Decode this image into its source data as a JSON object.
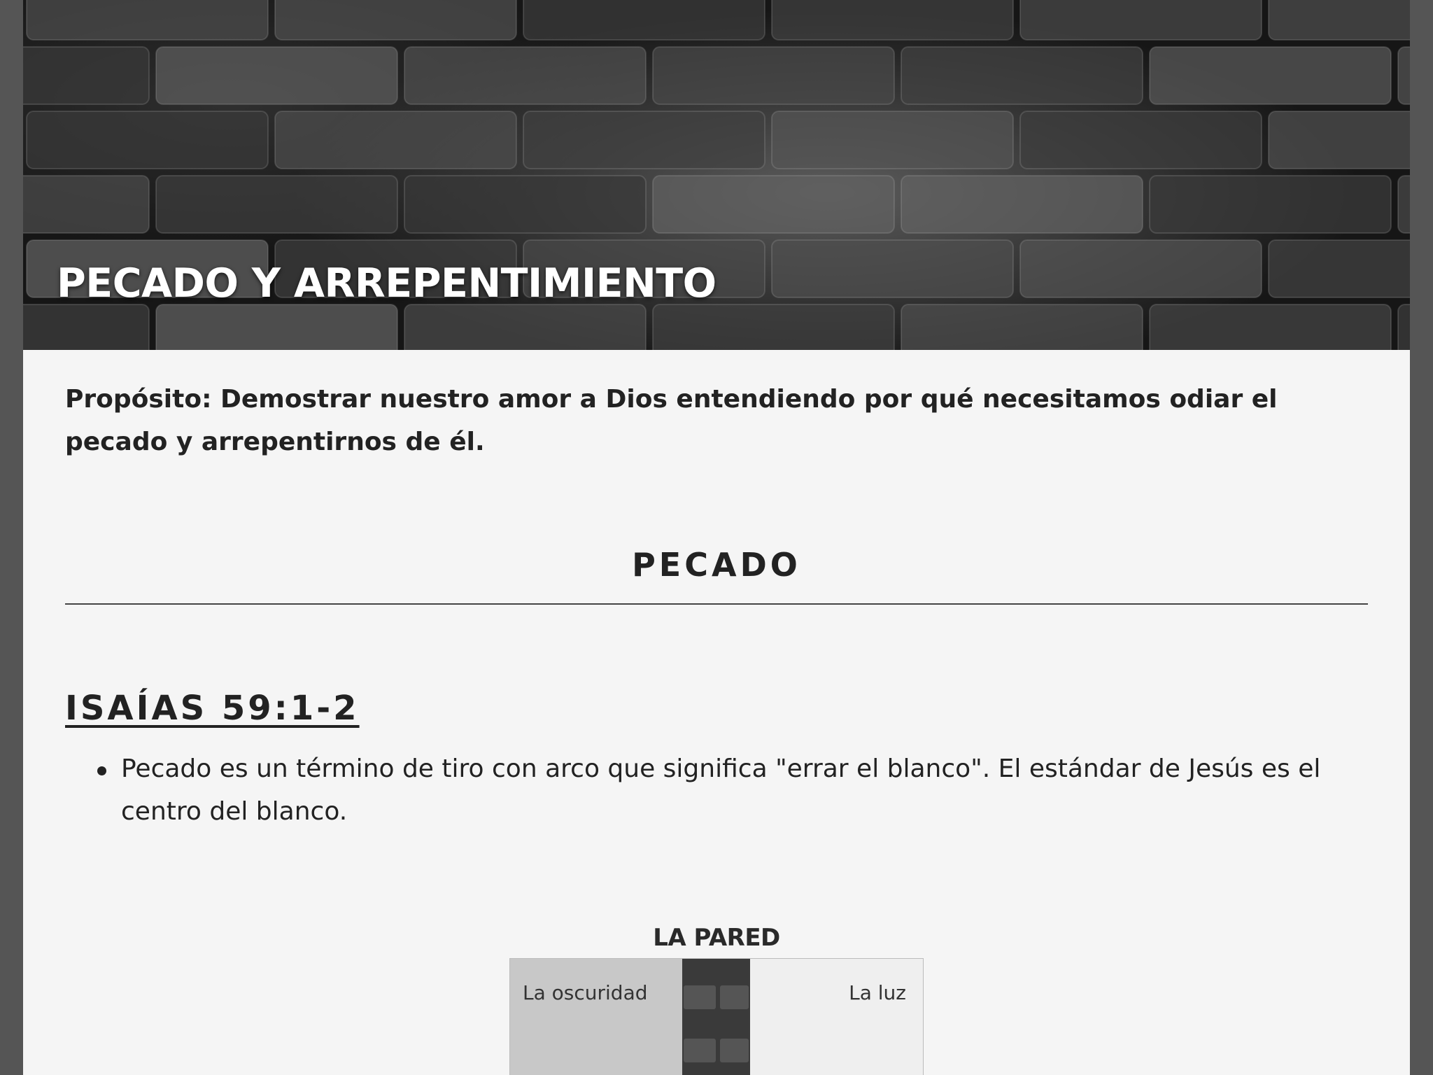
{
  "header": {
    "title": "PECADO Y ARREPENTIMIENTO"
  },
  "purpose": "Propósito: Demostrar nuestro amor a Dios entendiendo por qué necesitamos odiar el pecado y arrepentirnos de él.",
  "section": {
    "title": "PECADO"
  },
  "passage": {
    "reference": "ISAÍAS 59:1-2",
    "bullets": [
      "Pecado es un término de tiro con arco que significa \"errar el blanco\". El estándar de Jesús es el centro del blanco."
    ]
  },
  "wall_diagram": {
    "title": "LA PARED",
    "left_label": "La oscuridad",
    "right_label": "La luz"
  },
  "colors": {
    "page_background": "#f5f5f5",
    "outer_background": "#555555",
    "text": "#222222",
    "hero_title": "#ffffff"
  }
}
